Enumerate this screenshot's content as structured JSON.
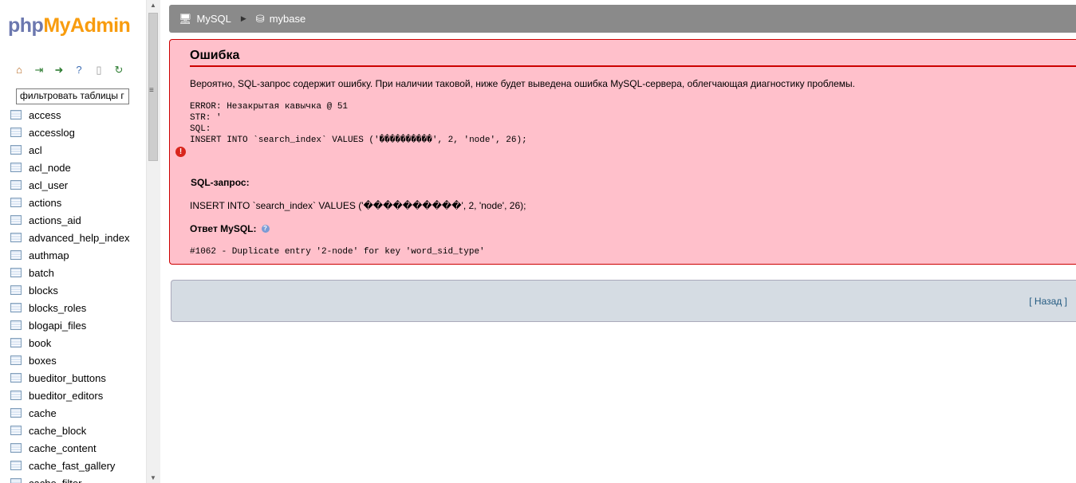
{
  "nav": {
    "logo_php": "php",
    "logo_myadmin": "MyAdmin",
    "toolbar_icons": [
      "home-icon",
      "exit-icon",
      "sql-icon",
      "help-icon",
      "docs-icon",
      "reload-icon"
    ],
    "filter_value": "фильтровать таблицы г",
    "tables": [
      "access",
      "accesslog",
      "acl",
      "acl_node",
      "acl_user",
      "actions",
      "actions_aid",
      "advanced_help_index",
      "authmap",
      "batch",
      "blocks",
      "blocks_roles",
      "blogapi_files",
      "book",
      "boxes",
      "bueditor_buttons",
      "bueditor_editors",
      "cache",
      "cache_block",
      "cache_content",
      "cache_fast_gallery",
      "cache_filter"
    ]
  },
  "breadcrumb": {
    "server": "MySQL",
    "database": "mybase"
  },
  "error": {
    "title": "Ошибка",
    "message": "Вероятно, SQL-запрос содержит ошибку. При наличии таковой, ниже будет выведена ошибка MySQL-сервера, облегчающая диагностику проблемы.",
    "detail": "ERROR: Незакрытая кавычка @ 51\nSTR: '\nSQL:\nINSERT INTO `search_index` VALUES ('����������', 2, 'node', 26);",
    "sql_heading": "SQL-запрос:",
    "sql_text": "INSERT INTO `search_index` VALUES ('����������', 2, 'node', 26);",
    "response_heading": "Ответ MySQL:",
    "response_code": "#1062 - Duplicate entry '2-node' for key 'word_sid_type'"
  },
  "back": {
    "open": "[",
    "label": "Назад",
    "close": "]"
  },
  "colors": {
    "error_bg": "#ffc0cb",
    "error_border": "#cc0000",
    "topbar": "#8a8a8a",
    "back_bg": "#d5dce3"
  }
}
